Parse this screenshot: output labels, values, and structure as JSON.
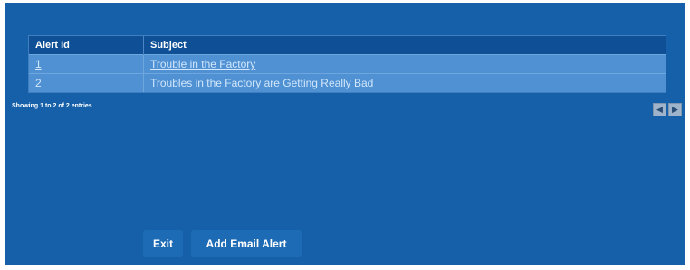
{
  "table": {
    "columns": [
      "Alert Id",
      "Subject"
    ],
    "rows": [
      {
        "id": "1",
        "subject": "Trouble in the Factory"
      },
      {
        "id": "2",
        "subject": "Troubles in the Factory are Getting Really Bad"
      }
    ],
    "info": "Showing 1 to 2 of 2 entries"
  },
  "pager": {
    "prev_icon": "chevron-left-icon",
    "next_icon": "chevron-right-icon"
  },
  "buttons": {
    "exit": "Exit",
    "add_email_alert": "Add Email Alert"
  },
  "colors": {
    "panel": "#1560a8",
    "header": "#0e4f96",
    "row": "#4f91d2",
    "button": "#1e6bb5"
  }
}
